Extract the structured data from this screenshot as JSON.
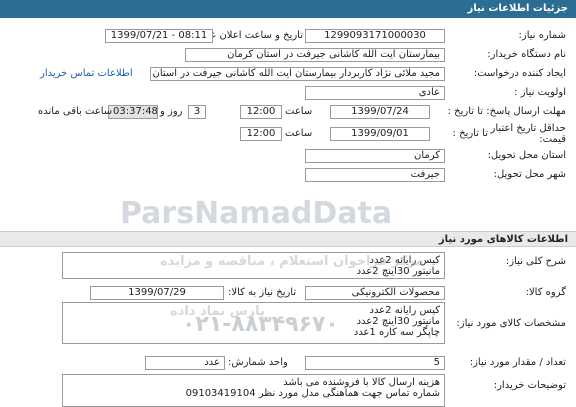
{
  "header": {
    "title": "جزئیات اطلاعات نیاز"
  },
  "fields": {
    "need_number": {
      "label": "شماره نیاز:",
      "value": "1299093171000030"
    },
    "announce_datetime": {
      "label": "تاریخ و ساعت اعلان عمومی:",
      "value": "1399/07/21 - 08:11"
    },
    "device_name": {
      "label": "نام دستگاه خریدار:",
      "value": "بیمارستان آیت الله کاشانی جیرفت در استان کرمان"
    },
    "creator": {
      "label": "ایجاد کننده درخواست:",
      "value": "مجید ملائی نژاد کاربردار بیمارستان آیت الله کاشانی جیرفت در استان کرمان",
      "contact_link": "اطلاعات تماس خریدار"
    },
    "priority": {
      "label": "اولویت نیاز :",
      "value": "عادی"
    },
    "deadline": {
      "label": "مهلت ارسال پاسخ: تا تاریخ :",
      "date": "1399/07/24",
      "time_label": "ساعت",
      "time": "12:00",
      "days": "3",
      "days_label": "روز و",
      "remaining": "03:37:48",
      "remaining_label": "ساعت باقی مانده"
    },
    "min_validity": {
      "label": "حداقل تاریخ اعتبار قیمت:",
      "to_date_label": "تا تاریخ :",
      "date": "1399/09/01",
      "time_label": "ساعت",
      "time": "12:00"
    },
    "province": {
      "label": "استان محل تحویل:",
      "value": "کرمان"
    },
    "city": {
      "label": "شهر محل تحویل:",
      "value": "جیرفت"
    }
  },
  "goods_section": {
    "title": "اطلاعات کالاهای مورد نیاز",
    "summary_label": "شرح کلی نیاز:",
    "summary": "کیس رایانه 2عدد\nمانیتور 30اینچ 2عدد",
    "group_label": "گروه کالا:",
    "group": "محصولات الکترونیکی",
    "need_date_label": "تاریخ نیاز به کالا:",
    "need_date": "1399/07/29",
    "specs_label": "مشخصات کالای مورد نیاز:",
    "specs": "کیس رایانه 2عدد\nمانیتور 30اینچ 2عدد\nچاپگر سه کاره 1عدد",
    "unit_label": "واحد شمارش:",
    "unit": "عدد",
    "qty_label": "تعداد / مقدار مورد نیاز:",
    "qty": "5",
    "buyer_notes_label": "توضیحات خریدار:",
    "buyer_notes": "هزینه ارسال کالا با فروشنده می باشد\nشماره تماس جهت هماهنگی مدل مورد نظر 09103419104"
  },
  "watermark": {
    "line1": "مرکز فراخوان استعلام  ، مناقصه و مزایده",
    "brand": "ParsNamadData",
    "line2": "پارس نماد داده",
    "phone": "۰۲۱-۸۸۳۴۹۶۷۰"
  }
}
